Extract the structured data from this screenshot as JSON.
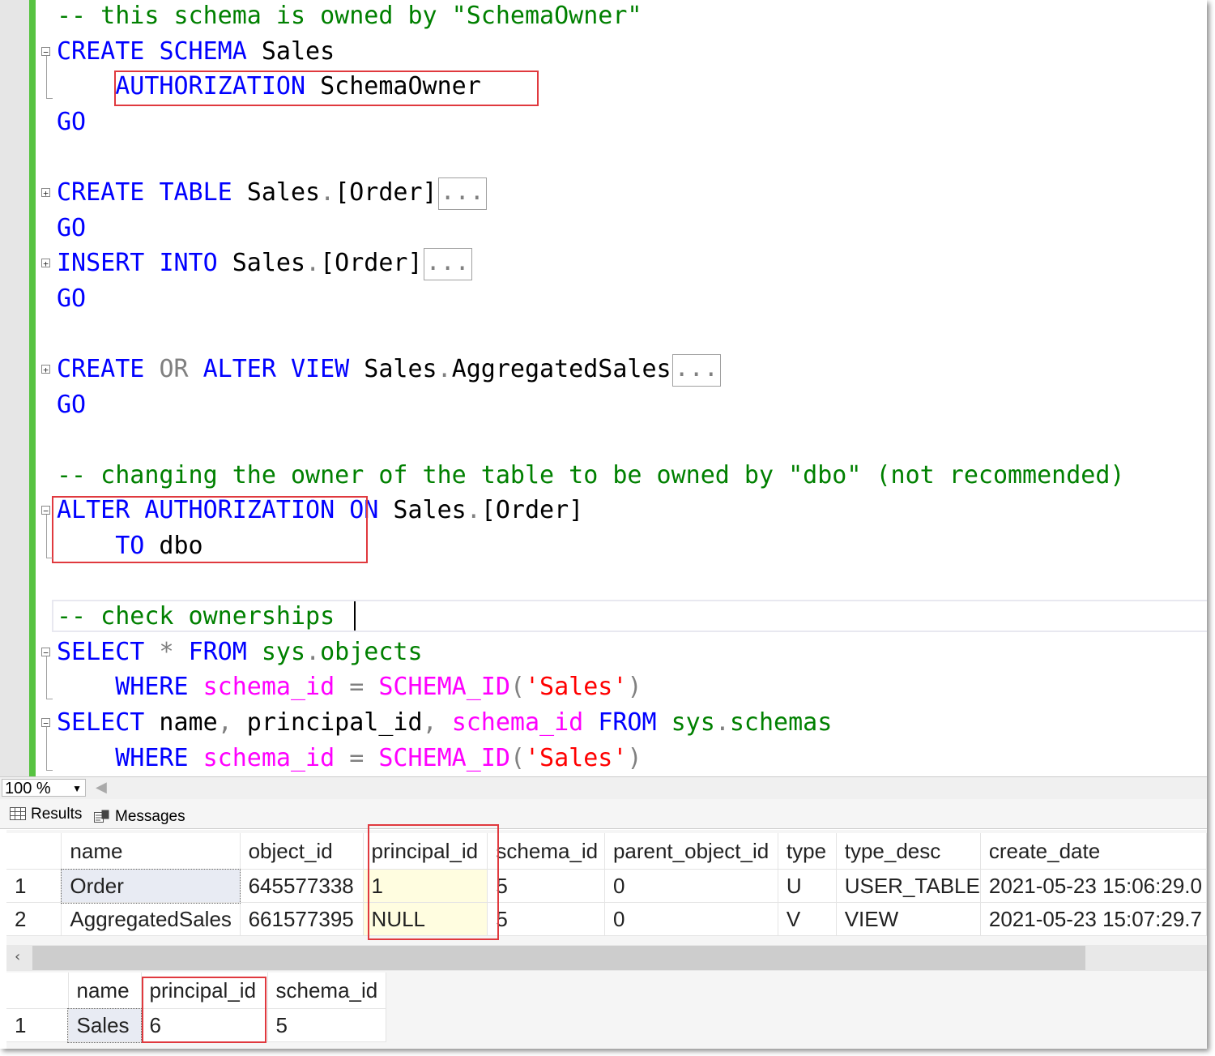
{
  "editor": {
    "lines": [
      [
        [
          "c",
          "-- this schema is owned by \"SchemaOwner\""
        ]
      ],
      [
        [
          "k",
          "CREATE"
        ],
        [
          "d",
          " "
        ],
        [
          "k",
          "SCHEMA"
        ],
        [
          "d",
          " Sales"
        ]
      ],
      [
        [
          "d",
          "    "
        ],
        [
          "k",
          "AUTHORIZATION"
        ],
        [
          "d",
          " SchemaOwner"
        ]
      ],
      [
        [
          "k",
          "GO"
        ]
      ],
      [
        [
          "d",
          ""
        ]
      ],
      [
        [
          "k",
          "CREATE"
        ],
        [
          "d",
          " "
        ],
        [
          "k",
          "TABLE"
        ],
        [
          "d",
          " Sales"
        ],
        [
          "g",
          "."
        ],
        [
          "d",
          "[Order]"
        ],
        [
          "dots",
          "..."
        ]
      ],
      [
        [
          "k",
          "GO"
        ]
      ],
      [
        [
          "k",
          "INSERT"
        ],
        [
          "d",
          " "
        ],
        [
          "k",
          "INTO"
        ],
        [
          "d",
          " Sales"
        ],
        [
          "g",
          "."
        ],
        [
          "d",
          "[Order]"
        ],
        [
          "dots",
          "..."
        ]
      ],
      [
        [
          "k",
          "GO"
        ]
      ],
      [
        [
          "d",
          ""
        ]
      ],
      [
        [
          "k",
          "CREATE"
        ],
        [
          "d",
          " "
        ],
        [
          "g",
          "OR"
        ],
        [
          "d",
          " "
        ],
        [
          "k",
          "ALTER"
        ],
        [
          "d",
          " "
        ],
        [
          "k",
          "VIEW"
        ],
        [
          "d",
          " Sales"
        ],
        [
          "g",
          "."
        ],
        [
          "d",
          "AggregatedSales"
        ],
        [
          "dots",
          "..."
        ]
      ],
      [
        [
          "k",
          "GO"
        ]
      ],
      [
        [
          "d",
          ""
        ]
      ],
      [
        [
          "c",
          "-- changing the owner of the table to be owned by \"dbo\" (not recommended)"
        ]
      ],
      [
        [
          "k",
          "ALTER"
        ],
        [
          "d",
          " "
        ],
        [
          "k",
          "AUTHORIZATION"
        ],
        [
          "d",
          " "
        ],
        [
          "k",
          "ON"
        ],
        [
          "d",
          " Sales"
        ],
        [
          "g",
          "."
        ],
        [
          "d",
          "[Order]"
        ]
      ],
      [
        [
          "d",
          "    "
        ],
        [
          "k",
          "TO"
        ],
        [
          "d",
          " dbo"
        ]
      ],
      [
        [
          "d",
          ""
        ]
      ],
      [
        [
          "c",
          "-- check ownerships"
        ]
      ],
      [
        [
          "k",
          "SELECT"
        ],
        [
          "d",
          " "
        ],
        [
          "g",
          "*"
        ],
        [
          "d",
          " "
        ],
        [
          "k",
          "FROM"
        ],
        [
          "d",
          " "
        ],
        [
          "s",
          "sys"
        ],
        [
          "g",
          "."
        ],
        [
          "s",
          "objects"
        ]
      ],
      [
        [
          "d",
          "    "
        ],
        [
          "k",
          "WHERE"
        ],
        [
          "d",
          " "
        ],
        [
          "p",
          "schema_id"
        ],
        [
          "d",
          " "
        ],
        [
          "g",
          "="
        ],
        [
          "d",
          " "
        ],
        [
          "p",
          "SCHEMA_ID"
        ],
        [
          "g",
          "("
        ],
        [
          "r",
          "'Sales'"
        ],
        [
          "g",
          ")"
        ]
      ],
      [
        [
          "k",
          "SELECT"
        ],
        [
          "d",
          " name"
        ],
        [
          "g",
          ","
        ],
        [
          "d",
          " principal_id"
        ],
        [
          "g",
          ","
        ],
        [
          "d",
          " "
        ],
        [
          "p",
          "schema_id"
        ],
        [
          "d",
          " "
        ],
        [
          "k",
          "FROM"
        ],
        [
          "d",
          " "
        ],
        [
          "s",
          "sys"
        ],
        [
          "g",
          "."
        ],
        [
          "s",
          "schemas"
        ]
      ],
      [
        [
          "d",
          "    "
        ],
        [
          "k",
          "WHERE"
        ],
        [
          "d",
          " "
        ],
        [
          "p",
          "schema_id"
        ],
        [
          "d",
          " "
        ],
        [
          "g",
          "="
        ],
        [
          "d",
          " "
        ],
        [
          "p",
          "SCHEMA_ID"
        ],
        [
          "g",
          "("
        ],
        [
          "r",
          "'Sales'"
        ],
        [
          "g",
          ")"
        ]
      ]
    ],
    "fold_markers": [
      "−",
      "+",
      "+",
      "+",
      "−",
      "−",
      "−"
    ]
  },
  "zoom": {
    "value": "100 %"
  },
  "tabs": {
    "results": "Results",
    "messages": "Messages"
  },
  "grid1": {
    "columns": [
      "name",
      "object_id",
      "principal_id",
      "schema_id",
      "parent_object_id",
      "type",
      "type_desc",
      "create_date"
    ],
    "rows": [
      {
        "num": "1",
        "cells": [
          "Order",
          "645577338",
          "1",
          "5",
          "0",
          "U",
          "USER_TABLE",
          "2021-05-23 15:06:29.0"
        ]
      },
      {
        "num": "2",
        "cells": [
          "AggregatedSales",
          "661577395",
          "NULL",
          "5",
          "0",
          "V",
          "VIEW",
          "2021-05-23 15:07:29.7"
        ]
      }
    ]
  },
  "grid2": {
    "columns": [
      "name",
      "principal_id",
      "schema_id"
    ],
    "rows": [
      {
        "num": "1",
        "cells": [
          "Sales",
          "6",
          "5"
        ]
      }
    ]
  },
  "colors": {
    "keyword": "#0000ff",
    "comment": "#008000",
    "highlight_box": "#e0393e",
    "change_bar": "#57c341"
  }
}
